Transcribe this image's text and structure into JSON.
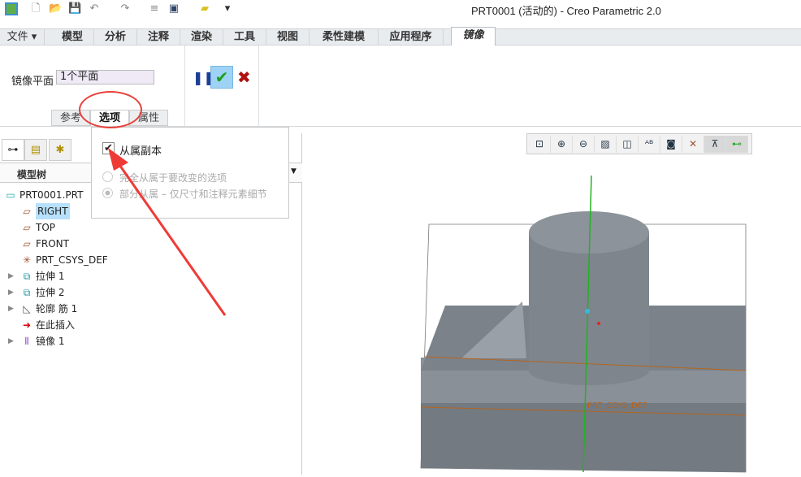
{
  "window": {
    "title": "PRT0001 (活动的) - Creo Parametric 2.0"
  },
  "quick_access": [
    "app-icon",
    "new-icon",
    "open-icon",
    "save-icon",
    "undo-icon",
    "redo-icon",
    "regenerate-icon",
    "windows-icon",
    "close-window-icon",
    "customize-icon"
  ],
  "menu_tabs": [
    {
      "label": "文件 ▾"
    },
    {
      "label": "模型"
    },
    {
      "label": "分析"
    },
    {
      "label": "注释"
    },
    {
      "label": "渲染"
    },
    {
      "label": "工具"
    },
    {
      "label": "视图"
    },
    {
      "label": "柔性建模"
    },
    {
      "label": "应用程序"
    },
    {
      "label": "镜像",
      "active": true
    }
  ],
  "ribbon": {
    "plane_label": "镜像平面",
    "plane_value": "1个平面",
    "subtabs": [
      {
        "label": "参考"
      },
      {
        "label": "选项",
        "active": true
      },
      {
        "label": "属性"
      }
    ]
  },
  "options_popup": {
    "checkbox_label": "从属副本",
    "checked": true,
    "radio1": "完全从属于要改变的选项",
    "radio2": "部分从属 – 仅尺寸和注释元素细节",
    "radio_selected": 2,
    "disabled": true
  },
  "model_tree": {
    "title": "模型树",
    "items": [
      {
        "label": "PRT0001.PRT",
        "icon": "part-icon"
      },
      {
        "label": "RIGHT",
        "icon": "datum-plane-icon",
        "selected": true
      },
      {
        "label": "TOP",
        "icon": "datum-plane-icon"
      },
      {
        "label": "FRONT",
        "icon": "datum-plane-icon"
      },
      {
        "label": "PRT_CSYS_DEF",
        "icon": "csys-icon"
      },
      {
        "label": "拉伸 1",
        "icon": "extrude-icon",
        "expandable": true
      },
      {
        "label": "拉伸 2",
        "icon": "extrude-icon",
        "expandable": true
      },
      {
        "label": "轮廓 筋 1",
        "icon": "rib-icon",
        "expandable": true
      },
      {
        "label": "在此插入",
        "icon": "insert-here-icon"
      },
      {
        "label": "镜像 1",
        "icon": "mirror-icon",
        "expandable": true
      }
    ]
  },
  "view_toolbar": [
    "refit-icon",
    "zoom-in-icon",
    "zoom-out-icon",
    "repaint-icon",
    "display-style-icon",
    "saved-views-icon",
    "view-manager-icon",
    "datum-display-icon",
    "annotation-display-icon",
    "spin-center-icon"
  ],
  "graphics": {
    "csys_label": "PRT_CSYS_DEF"
  },
  "colors": {
    "accent_red": "#e8403a",
    "model_gray": "#858c94",
    "confirm_green": "#1f9e1f"
  }
}
